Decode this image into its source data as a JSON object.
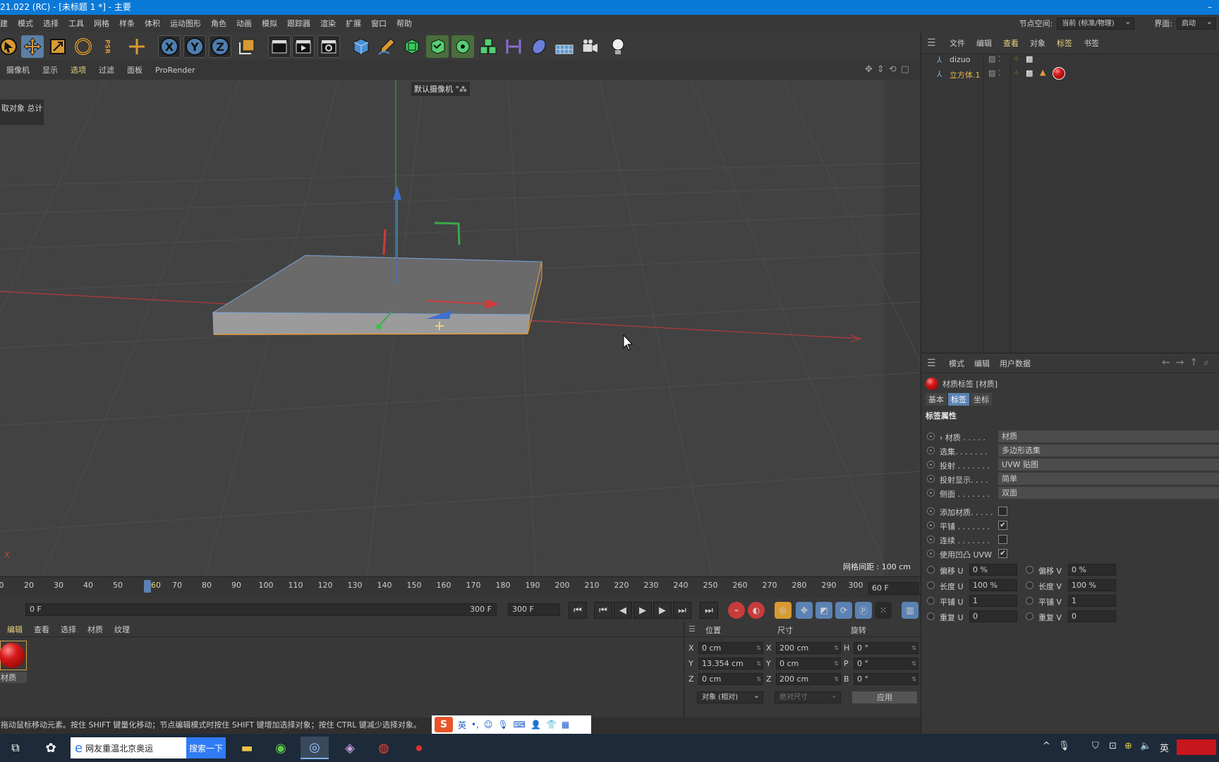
{
  "window": {
    "title": "21.022 (RC) - [未标题 1 *] - 主要",
    "minimize_glyph": "–"
  },
  "menubar": {
    "items": [
      "建",
      "模式",
      "选择",
      "工具",
      "网格",
      "样条",
      "体积",
      "运动图形",
      "角色",
      "动画",
      "模拟",
      "跟踪器",
      "渲染",
      "扩展",
      "窗口",
      "帮助"
    ],
    "node_space_label": "节点空间:",
    "node_space_value": "当前 (标准/物理)",
    "interface_label": "界面:",
    "interface_value": "启动"
  },
  "toolbar": {
    "axis_x": "X",
    "axis_y": "Y",
    "axis_z": "Z",
    "psr_label": "PSR"
  },
  "viewport_menu": {
    "items": [
      "摄像机",
      "显示",
      "选项",
      "过滤",
      "面板",
      "ProRender"
    ]
  },
  "viewport": {
    "info_text": "取对象 总计",
    "camera_label": "默认摄像机 °⁂",
    "grid_spacing": "网格间距 : 100 cm",
    "axis_indicator": "X"
  },
  "timeline": {
    "ticks": [
      "0",
      "20",
      "30",
      "40",
      "50",
      "60",
      "70",
      "80",
      "90",
      "100",
      "110",
      "120",
      "130",
      "140",
      "150",
      "160",
      "170",
      "180",
      "190",
      "200",
      "210",
      "220",
      "230",
      "240",
      "250",
      "260",
      "270",
      "280",
      "290",
      "300"
    ],
    "current_frame": "60",
    "end_frame_display": "60 F",
    "range_start": "0 F",
    "range_end": "300 F",
    "max_frame": "300 F"
  },
  "material_manager": {
    "menu": [
      "编辑",
      "查看",
      "选择",
      "材质",
      "纹理"
    ],
    "materials": [
      {
        "name": "材质"
      }
    ]
  },
  "coordinates": {
    "headers": [
      "位置",
      "尺寸",
      "旋转"
    ],
    "rows": [
      {
        "axis": "X",
        "pos": "0 cm",
        "size_axis": "X",
        "size": "200 cm",
        "rot_axis": "H",
        "rot": "0 °"
      },
      {
        "axis": "Y",
        "pos": "13.354 cm",
        "size_axis": "Y",
        "size": "0 cm",
        "rot_axis": "P",
        "rot": "0 °"
      },
      {
        "axis": "Z",
        "pos": "0 cm",
        "size_axis": "Z",
        "size": "200 cm",
        "rot_axis": "B",
        "rot": "0 °"
      }
    ],
    "mode_select": "对象 (相对)",
    "size_select": "绝对尺寸",
    "apply_button": "应用"
  },
  "statusbar": {
    "text": "拖动鼠标移动元素。按住 SHIFT 键量化移动；节点编辑模式时按住 SHIFT 键增加选择对象；按住 CTRL 键减少选择对象。"
  },
  "ime": {
    "logo": "S",
    "lang": "英"
  },
  "object_manager": {
    "menu": [
      "文件",
      "编辑",
      "查看",
      "对象",
      "标签",
      "书签"
    ],
    "objects": [
      {
        "name": "dizuo",
        "color": "#cfcfcf"
      },
      {
        "name": "立方体.1",
        "color": "#e7b84a"
      }
    ]
  },
  "attribute_manager": {
    "menu": [
      "模式",
      "编辑",
      "用户数据"
    ],
    "title": "材质标签 [材质]",
    "tabs": [
      "基本",
      "标签",
      "坐标"
    ],
    "active_tab": "标签",
    "section": "标签属性",
    "fields": [
      {
        "label": "› 材质 . . . . .",
        "value": "材质"
      },
      {
        "label": "选集. . . . . . .",
        "value": "多边形选集"
      },
      {
        "label": "投射 . . . . . . .",
        "value": "UVW 贴图"
      },
      {
        "label": "投射显示. . . .",
        "value": "简单"
      },
      {
        "label": "侧面 . . . . . . .",
        "value": "双面"
      }
    ],
    "checkboxes": [
      {
        "label": "添加材质. . . . .",
        "checked": false
      },
      {
        "label": "平铺 . . . . . . .",
        "checked": true
      },
      {
        "label": "连续 . . . . . . .",
        "checked": false
      },
      {
        "label": "使用凹凸 UVW",
        "checked": true
      }
    ],
    "uv_fields": [
      {
        "label_u": "偏移 U",
        "value_u": "0 %",
        "label_v": "偏移 V",
        "value_v": "0 %"
      },
      {
        "label_u": "长度 U",
        "value_u": "100 %",
        "label_v": "长度 V",
        "value_v": "100 %"
      },
      {
        "label_u": "平铺 U",
        "value_u": "1",
        "label_v": "平铺 V",
        "value_v": "1"
      },
      {
        "label_u": "重复 U",
        "value_u": "0",
        "label_v": "重复 V",
        "value_v": "0"
      }
    ]
  },
  "taskbar": {
    "search_text": "网友重温北京奥运",
    "search_button": "搜索一下",
    "tray_lang": "英"
  }
}
